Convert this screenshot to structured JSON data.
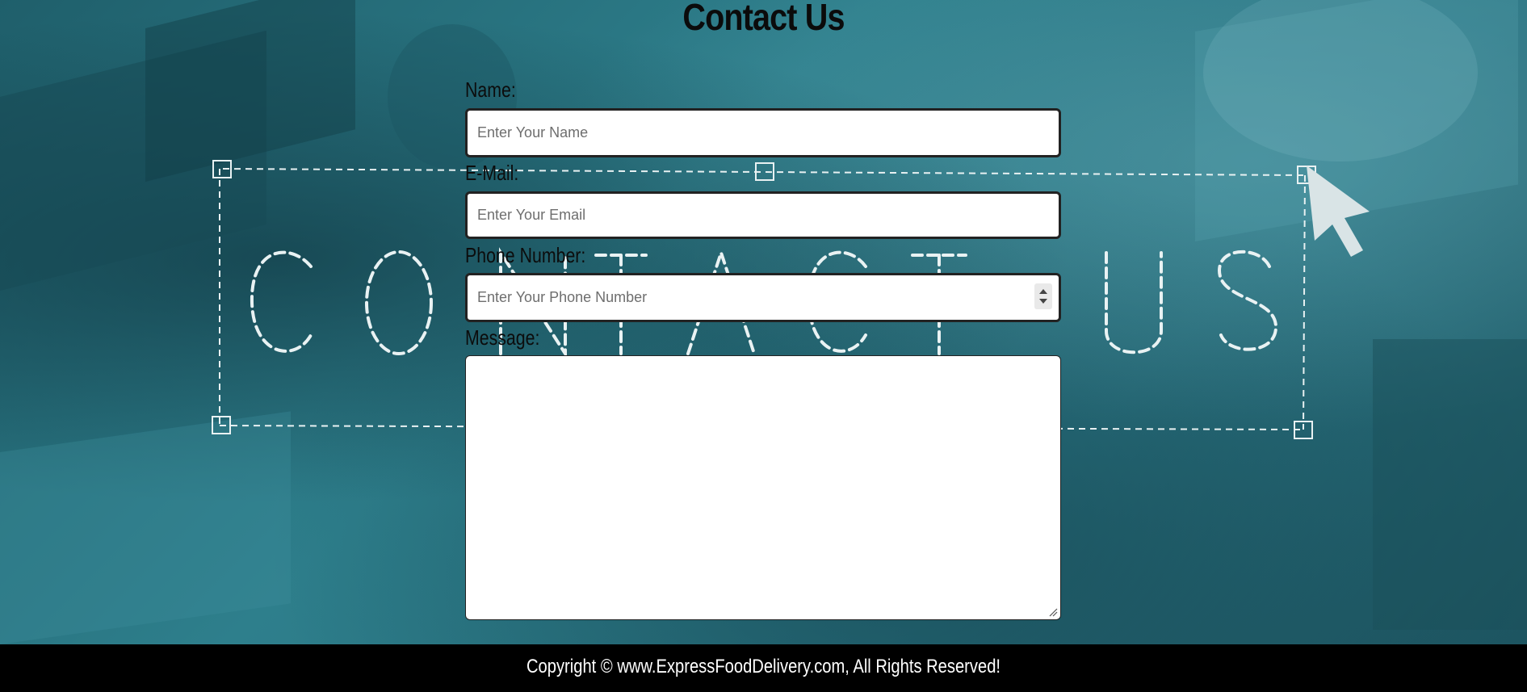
{
  "page": {
    "title": "Contact Us"
  },
  "background": {
    "overlay_word": "CONTACT US",
    "tint_color": "#2a7480"
  },
  "form": {
    "name": {
      "label": "Name:",
      "placeholder": "Enter Your Name",
      "value": ""
    },
    "email": {
      "label": "E-Mail:",
      "placeholder": "Enter Your Email",
      "value": ""
    },
    "phone": {
      "label": "Phone Number:",
      "placeholder": "Enter Your Phone Number",
      "value": ""
    },
    "message": {
      "label": "Message:",
      "placeholder": "",
      "value": ""
    }
  },
  "footer": {
    "text": "Copyright © www.ExpressFoodDelivery.com, All Rights Reserved!",
    "background_color": "#000000"
  }
}
